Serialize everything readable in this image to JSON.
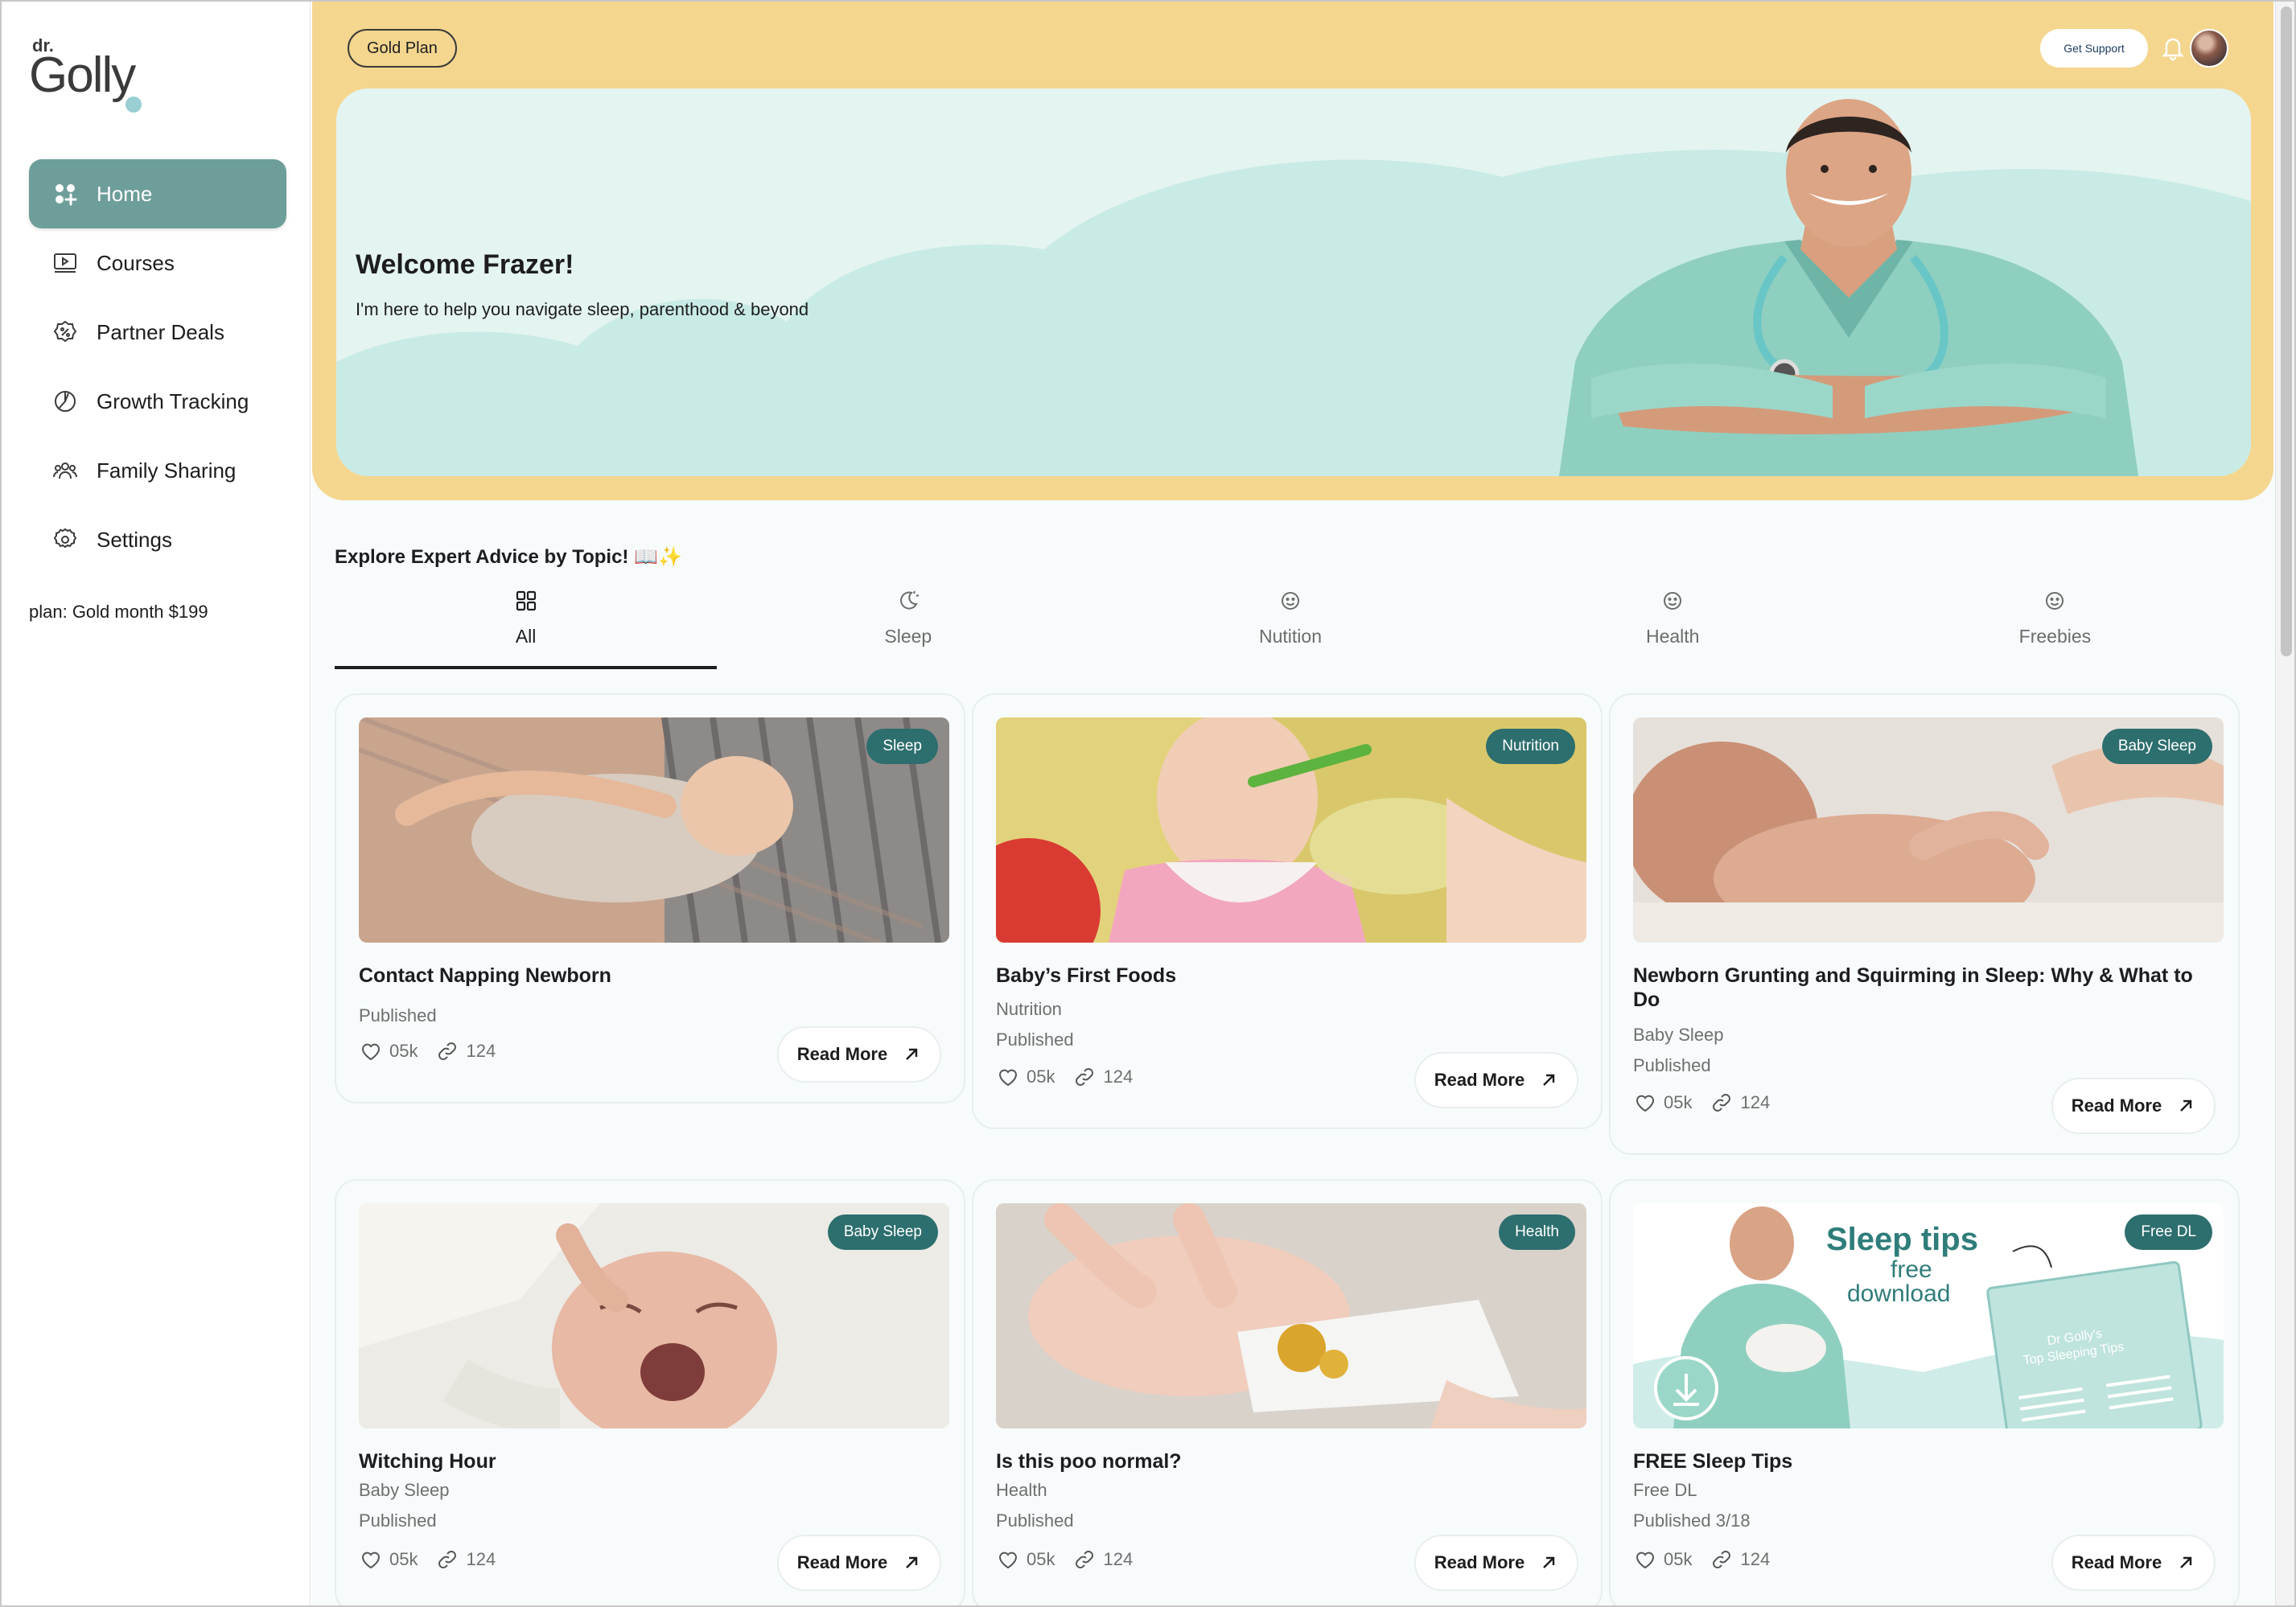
{
  "brand": {
    "logo_small": "dr.",
    "logo_text": "Golly"
  },
  "sidebar": {
    "items": [
      {
        "label": "Home",
        "icon": "home-grid-icon",
        "active": true
      },
      {
        "label": "Courses",
        "icon": "video-player-icon",
        "active": false
      },
      {
        "label": "Partner Deals",
        "icon": "discount-badge-icon",
        "active": false
      },
      {
        "label": "Growth Tracking",
        "icon": "pie-chart-icon",
        "active": false
      },
      {
        "label": "Family Sharing",
        "icon": "users-icon",
        "active": false
      },
      {
        "label": "Settings",
        "icon": "gear-icon",
        "active": false
      }
    ],
    "plan": "plan: Gold month $199"
  },
  "header": {
    "plan_badge": "Gold Plan",
    "support_label": "Get Support",
    "bell_icon": "bell-icon",
    "avatar": "user-avatar"
  },
  "hero": {
    "title": "Welcome Frazer!",
    "subtitle": "I'm here to help you navigate sleep, parenthood & beyond"
  },
  "explore": {
    "title": "Explore Expert Advice by Topic! 📖✨",
    "tabs": [
      {
        "label": "All",
        "icon": "grid-icon",
        "active": true
      },
      {
        "label": "Sleep",
        "icon": "moon-icon",
        "active": false
      },
      {
        "label": "Nutition",
        "icon": "smiley-icon",
        "active": false
      },
      {
        "label": "Health",
        "icon": "smiley-icon",
        "active": false
      },
      {
        "label": "Freebies",
        "icon": "smiley-icon",
        "active": false
      }
    ]
  },
  "cards": [
    {
      "badge": "Sleep",
      "title": "Contact Napping Newborn",
      "category": "",
      "status": "Published",
      "likes": "05k",
      "links": "124",
      "cta": "Read More"
    },
    {
      "badge": "Nutrition",
      "title": "Baby’s First Foods",
      "category": "Nutrition",
      "status": "Published",
      "likes": "05k",
      "links": "124",
      "cta": "Read More"
    },
    {
      "badge": "Baby Sleep",
      "title": "Newborn Grunting and Squirming in Sleep: Why & What to Do",
      "category": "Baby Sleep",
      "status": "Published",
      "likes": "05k",
      "links": "124",
      "cta": "Read More"
    },
    {
      "badge": "Baby Sleep",
      "title": "Witching Hour",
      "category": "Baby Sleep",
      "status": "Published",
      "likes": "05k",
      "links": "124",
      "cta": "Read More"
    },
    {
      "badge": "Health",
      "title": "Is this poo normal?",
      "category": "Health",
      "status": "Published",
      "likes": "05k",
      "links": "124",
      "cta": "Read More"
    },
    {
      "badge": "Free DL",
      "title": "FREE Sleep Tips",
      "category": "Free DL",
      "status": "Published 3/18",
      "likes": "05k",
      "links": "124",
      "cta": "Read More"
    }
  ],
  "promo": {
    "line1": "Sleep tips",
    "line2": "free",
    "line3": "download",
    "booklet_title": "Dr Golly's",
    "booklet_sub": "Top Sleeping Tips"
  },
  "colors": {
    "accent": "#6e9e9a",
    "hero_frame": "#f4d68e",
    "hero_bg": "#e4f4f1",
    "badge": "#2d6e6e"
  }
}
